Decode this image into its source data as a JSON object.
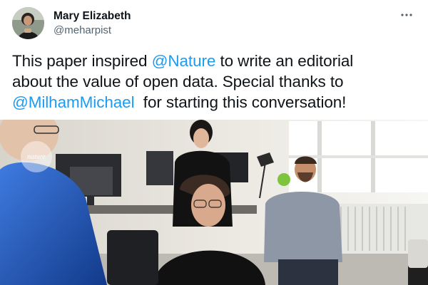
{
  "author": {
    "display_name": "Mary Elizabeth",
    "handle": "@meharpist",
    "avatar_icon": "profile-photo"
  },
  "menu": {
    "icon": "more-horizontal-icon"
  },
  "tweet": {
    "line1_pre": "This paper inspired ",
    "mention1": "@Nature",
    "line1_post": " to write an editorial",
    "line2": "about the value of open data. Special thanks to",
    "mention2": "@MilhamMichael",
    "line3_post": "  for starting this conversation!"
  },
  "media": {
    "watermark_text": "nature",
    "description_colors": {
      "accent_blue": "#1d9bf0",
      "shirt_blue": "#1e4fa8",
      "black_top": "#111111"
    }
  }
}
